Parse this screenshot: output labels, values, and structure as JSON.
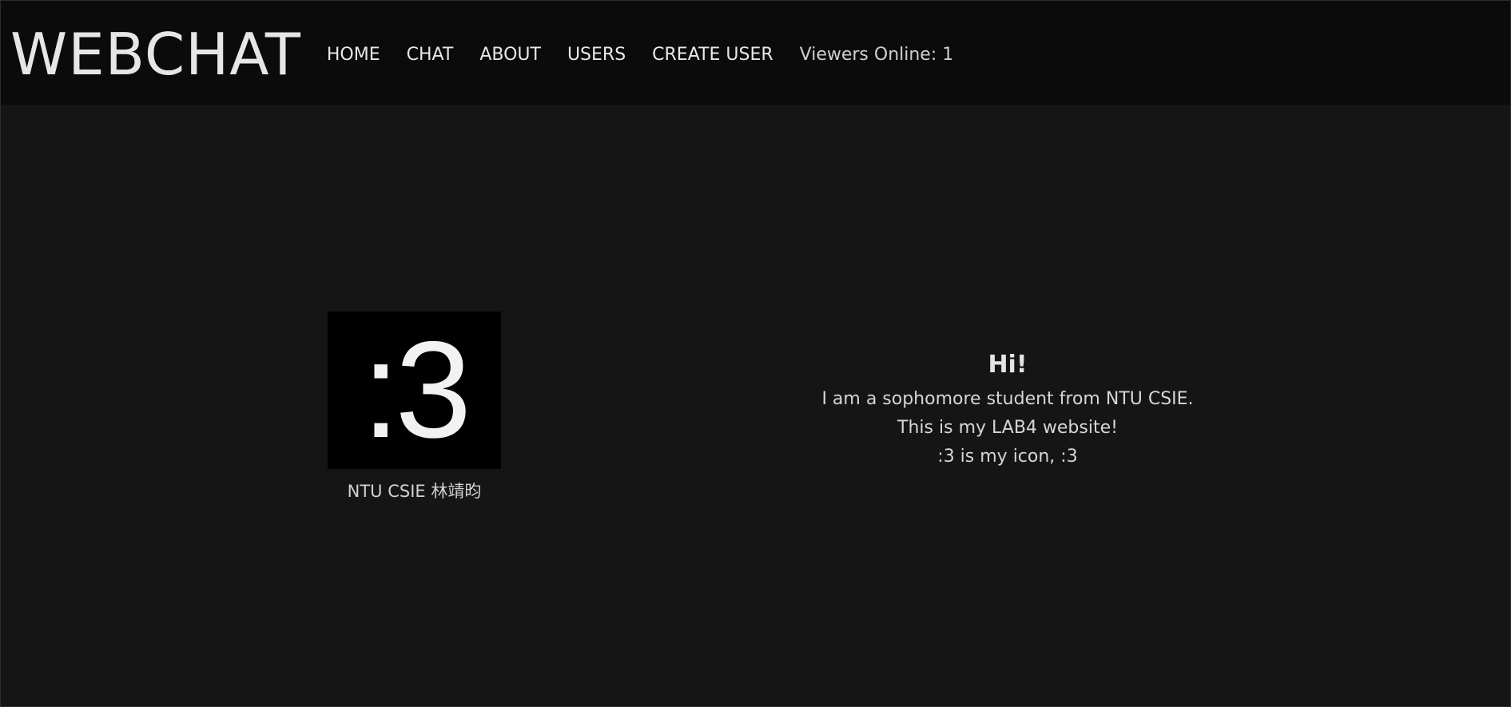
{
  "header": {
    "brand": "WEBCHAT",
    "nav": [
      {
        "label": "HOME"
      },
      {
        "label": "CHAT"
      },
      {
        "label": "ABOUT"
      },
      {
        "label": "USERS"
      },
      {
        "label": "CREATE USER"
      }
    ],
    "viewers": "Viewers Online: 1"
  },
  "profile": {
    "avatar_text": ":3",
    "caption": "NTU CSIE 林靖昀"
  },
  "intro": {
    "title": "Hi!",
    "lines": [
      "I am a sophomore student from NTU CSIE.",
      "This is my LAB4 website!",
      ":3 is my icon, :3"
    ]
  },
  "colors": {
    "page_background": "#151515",
    "header_background": "#0b0b0b",
    "text": "#e6e6e6"
  }
}
